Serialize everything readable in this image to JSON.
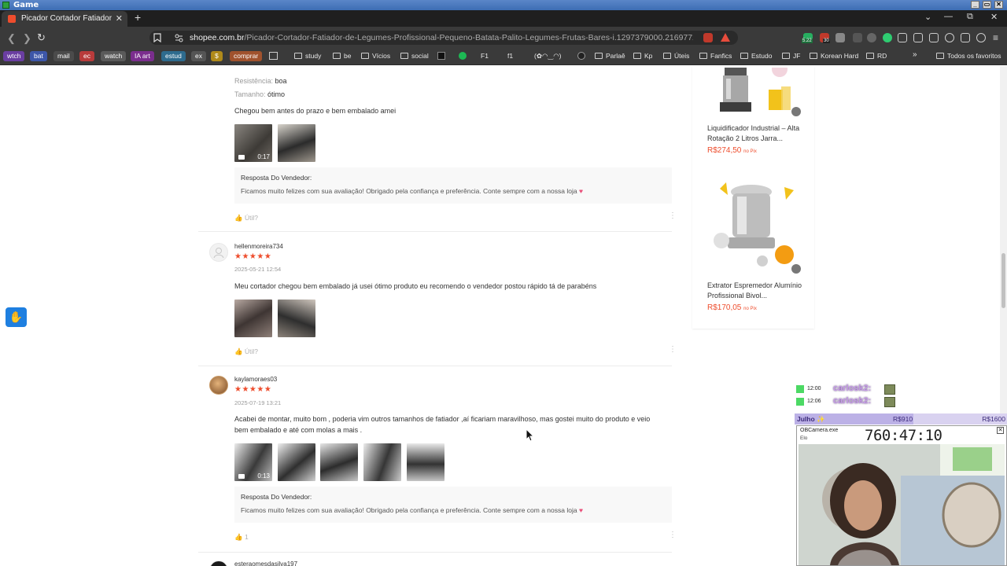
{
  "window": {
    "title": "Game",
    "controls": [
      "_",
      "▭",
      "✕"
    ]
  },
  "tab": {
    "label": "Picador Cortador Fatiador de Le",
    "close": "✕"
  },
  "tabstrip": {
    "new_tab": "+",
    "dropdown": "⌄",
    "minimize": "—",
    "maximize": "⧉",
    "close": "✕"
  },
  "nav": {
    "url_domain": "shopee.com.br",
    "url_path": "/Picador-Cortador-Fatiador-de-Legumes-Profissional-Pequeno-Batata-Palito-Legumes-Frutas-Bares-i.1297379000.21697729132?extraPara...",
    "ext_badges": [
      "5.22",
      "30"
    ]
  },
  "bookmarks": {
    "chips": [
      {
        "label": "wtch",
        "color": "#6a3ea1"
      },
      {
        "label": "bat",
        "color": "#3d57a8"
      },
      {
        "label": "mail",
        "color": "#4b4b4b"
      },
      {
        "label": "ec",
        "color": "#b83b3b"
      },
      {
        "label": "watch",
        "color": "#5a5a5a"
      },
      {
        "label": "IA art",
        "color": "#7b2e8e"
      },
      {
        "label": "estud",
        "color": "#2e6b8e"
      },
      {
        "label": "ex",
        "color": "#555555"
      },
      {
        "label": "$",
        "color": "#b08a1a"
      },
      {
        "label": "comprar",
        "color": "#a0522d"
      }
    ],
    "items": [
      "study",
      "be",
      "Vícios",
      "social",
      "F1",
      "f1",
      "(✿◠‿◠)",
      "Parlaê",
      "Kp",
      "Úteis",
      "Fanfics",
      "Estudo",
      "JF",
      "Korean Hard",
      "RD"
    ],
    "overflow": "»",
    "all": "Todos os favoritos"
  },
  "reviews": [
    {
      "attr1_label": "Resistência:",
      "attr1_value": "boa",
      "attr2_label": "Tamanho:",
      "attr2_value": "ótimo",
      "text": "Chegou bem antes do prazo e bem embalado amei",
      "video_duration": "0:17",
      "seller_title": "Resposta Do Vendedor:",
      "seller_text": "Ficamos muito felizes com sua avaliação! Obrigado pela confiança e preferência. Conte sempre com a nossa loja",
      "like": "Útil?"
    },
    {
      "user": "hellenmoreira734",
      "stars": "★★★★★",
      "date": "2025-05-21 12:54",
      "text": "Meu cortador chegou bem embalado já usei ótimo produto eu recomendo o vendedor postou rápido tá de parabéns",
      "like": "Útil?"
    },
    {
      "user": "kaylamoraes03",
      "stars": "★★★★★",
      "date": "2025-07-19 13:21",
      "text_line1": "Acabei de montar, muito bom , poderia vim outros tamanhos de fatiador ,aí ficariam maravilhoso, mas gostei muito do produto e veio",
      "text_line2": "bem embalado e até com molas a mais .",
      "video_duration": "0:13",
      "seller_title": "Resposta Do Vendedor:",
      "seller_text": "Ficamos muito felizes com sua avaliação! Obrigado pela confiança e preferência. Conte sempre com a nossa loja",
      "like": "1"
    },
    {
      "user": "esteraomesdasilva197"
    }
  ],
  "heart": "♥",
  "sidebar": {
    "products": [
      {
        "title": "Liquidificador Industrial – Alta Rotação 2 Litros Jarra...",
        "price": "R$274,50",
        "pix": "no Pix"
      },
      {
        "title": "Extrator Espremedor Alumínio Profissional Bivol...",
        "price": "R$170,05",
        "pix": "no Pix"
      }
    ]
  },
  "overlay": {
    "chat": [
      {
        "time": "12:00",
        "name": "carlosk2:"
      },
      {
        "time": "12:06",
        "name": "carlosk2:"
      }
    ],
    "goal": {
      "label": "Julho ✨",
      "mid": "R$910",
      "end": "R$1600",
      "progress": 0.56
    },
    "obs": {
      "title": "OBCamera.exe",
      "label": "Elo",
      "timer": "760:47:10"
    }
  }
}
